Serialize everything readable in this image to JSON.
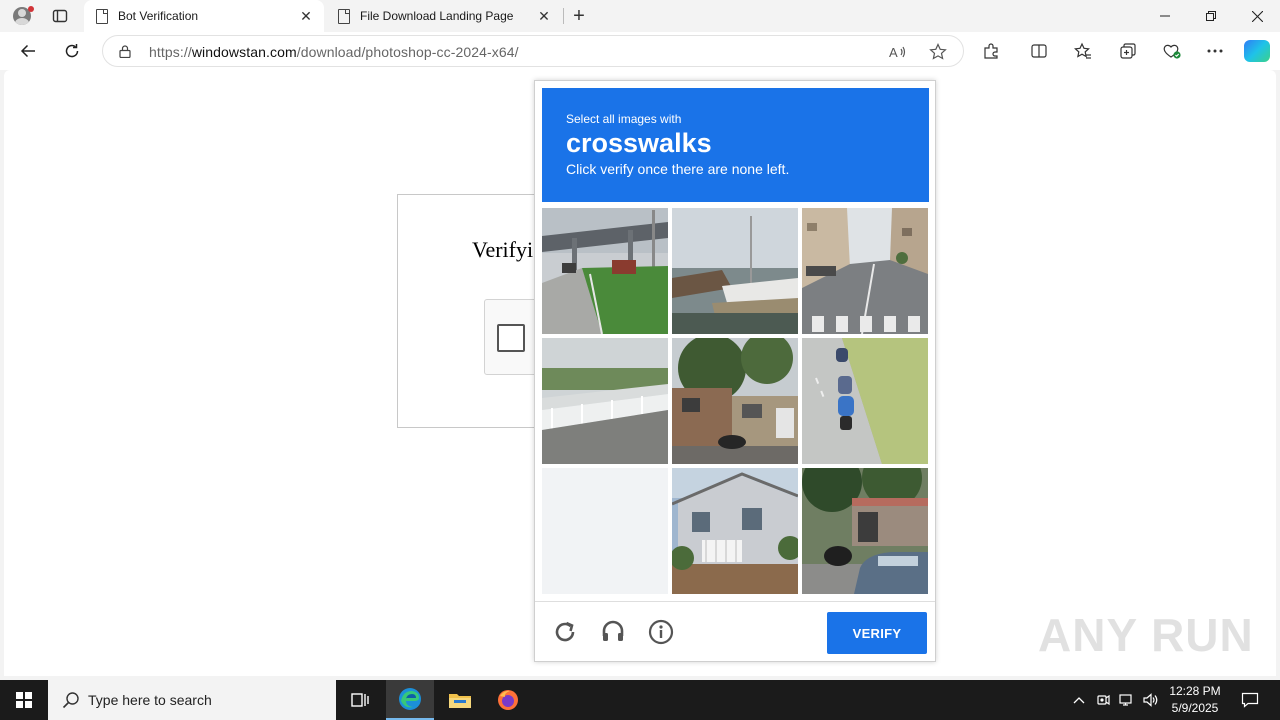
{
  "browser": {
    "tabs": [
      {
        "title": "Bot Verification",
        "active": true
      },
      {
        "title": "File Download Landing Page",
        "active": false
      }
    ],
    "url": {
      "scheme": "https://",
      "domain": "windowstan.com",
      "path": "/download/photoshop-cc-2024-x64/"
    }
  },
  "page": {
    "heading": "Verifyi"
  },
  "captcha": {
    "prompt_pre": "Select all images with",
    "target": "crosswalks",
    "instruction": "Click verify once there are none left.",
    "verify_label": "VERIFY",
    "tiles": [
      {
        "row": 1,
        "col": 1,
        "scene": "bridge-road-grass"
      },
      {
        "row": 1,
        "col": 2,
        "scene": "boats-harbor"
      },
      {
        "row": 1,
        "col": 3,
        "scene": "street-crosswalk"
      },
      {
        "row": 2,
        "col": 1,
        "scene": "bridge-railing"
      },
      {
        "row": 2,
        "col": 2,
        "scene": "houses-trees"
      },
      {
        "row": 2,
        "col": 3,
        "scene": "motorcycles-road"
      },
      {
        "row": 3,
        "col": 1,
        "scene": "blank-fading"
      },
      {
        "row": 3,
        "col": 2,
        "scene": "white-house"
      },
      {
        "row": 3,
        "col": 3,
        "scene": "car-motorcycle-shed"
      }
    ],
    "accent_color": "#1a73e8"
  },
  "watermark": "ANY RUN",
  "taskbar": {
    "search_placeholder": "Type here to search",
    "time": "12:28 PM",
    "date": "5/9/2025"
  }
}
